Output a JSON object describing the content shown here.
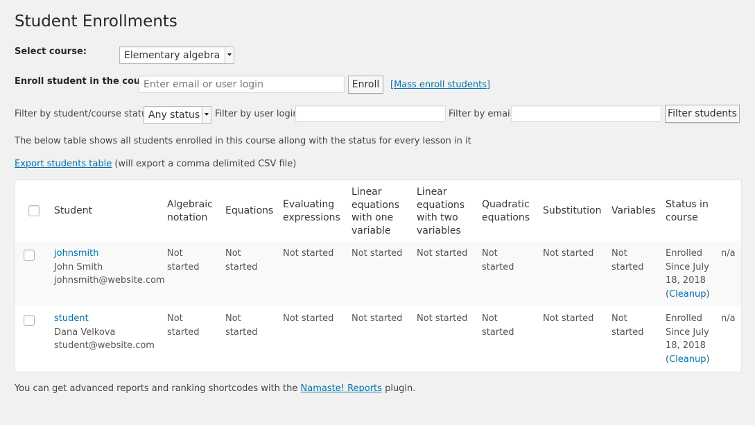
{
  "page": {
    "title": "Student Enrollments"
  },
  "course_select": {
    "label": "Select course:",
    "value": "Elementary algebra"
  },
  "enroll": {
    "label": "Enroll student in the course:",
    "placeholder": "Enter email or user login",
    "button": "Enroll",
    "mass_link": "[Mass enroll students]"
  },
  "filters": {
    "status_label": "Filter by student/course status:",
    "status_value": "Any status",
    "login_label": "Filter by user login:",
    "login_value": "",
    "email_label": "Filter by email:",
    "email_value": "",
    "button": "Filter students"
  },
  "description": "The below table shows all students enrolled in this course allong with the status for every lesson in it",
  "export": {
    "link": "Export students table",
    "note": "(will export a comma delimited CSV file)"
  },
  "table": {
    "headers": {
      "student": "Student",
      "lessons": [
        "Algebraic notation",
        "Equations",
        "Evaluating expressions",
        "Linear equations with one variable",
        "Linear equations with two variables",
        "Quadratic equations",
        "Substitution",
        "Variables"
      ],
      "status": "Status in course"
    },
    "rows": [
      {
        "login": "johnsmith",
        "name": "John Smith",
        "email": "johnsmith@website.com",
        "lessons": [
          "Not started",
          "Not started",
          "Not started",
          "Not started",
          "Not started",
          "Not started",
          "Not started",
          "Not started"
        ],
        "status_text": "Enrolled Since July 18, 2018",
        "cleanup_open": "(",
        "cleanup": "Cleanup",
        "cleanup_close": ")",
        "extra": "n/a"
      },
      {
        "login": "student",
        "name": "Dana Velkova",
        "email": "student@website.com",
        "lessons": [
          "Not started",
          "Not started",
          "Not started",
          "Not started",
          "Not started",
          "Not started",
          "Not started",
          "Not started"
        ],
        "status_text": "Enrolled Since July 18, 2018",
        "cleanup_open": "(",
        "cleanup": "Cleanup",
        "cleanup_close": ")",
        "extra": "n/a"
      }
    ]
  },
  "footer": {
    "before": "You can get advanced reports and ranking shortcodes with the",
    "link": "Namaste! Reports",
    "after": "plugin."
  }
}
